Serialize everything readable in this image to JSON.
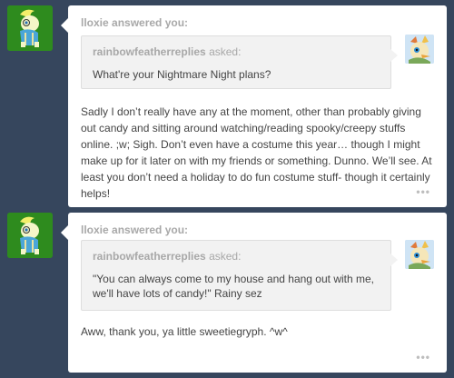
{
  "posts": [
    {
      "header": "lloxie answered you:",
      "asker_name": "rainbowfeatherreplies",
      "asked_label": "asked:",
      "question": "What're your Nightmare Night plans?",
      "answer": "Sadly I don’t really have any at the moment, other than probably giving out candy and sitting around watching/reading spooky/creepy stuffs online. ;w; Sigh. Don’t even have  a costume this year… though I might make up for it later on with my friends or something. Dunno. We’ll see. At least you don’t need a holiday to do fun costume stuff- though it certainly helps!",
      "more": "•••"
    },
    {
      "header": "lloxie answered you:",
      "asker_name": "rainbowfeatherreplies",
      "asked_label": "asked:",
      "question": "\"You can always come to my house and hang out with me, we'll have lots of candy!\" Rainy sez",
      "answer": "Aww, thank you, ya little sweetiegryph. ^w^",
      "more": "•••"
    }
  ],
  "colors": {
    "background": "#36465d",
    "card": "#ffffff",
    "ask_box": "#f2f2f2",
    "muted_text": "#a8a8a8",
    "body_text": "#444444"
  },
  "icons": {
    "answerer_avatar": "pony-avatar",
    "asker_avatar": "gryphon-avatar",
    "more": "more-dots-icon"
  }
}
